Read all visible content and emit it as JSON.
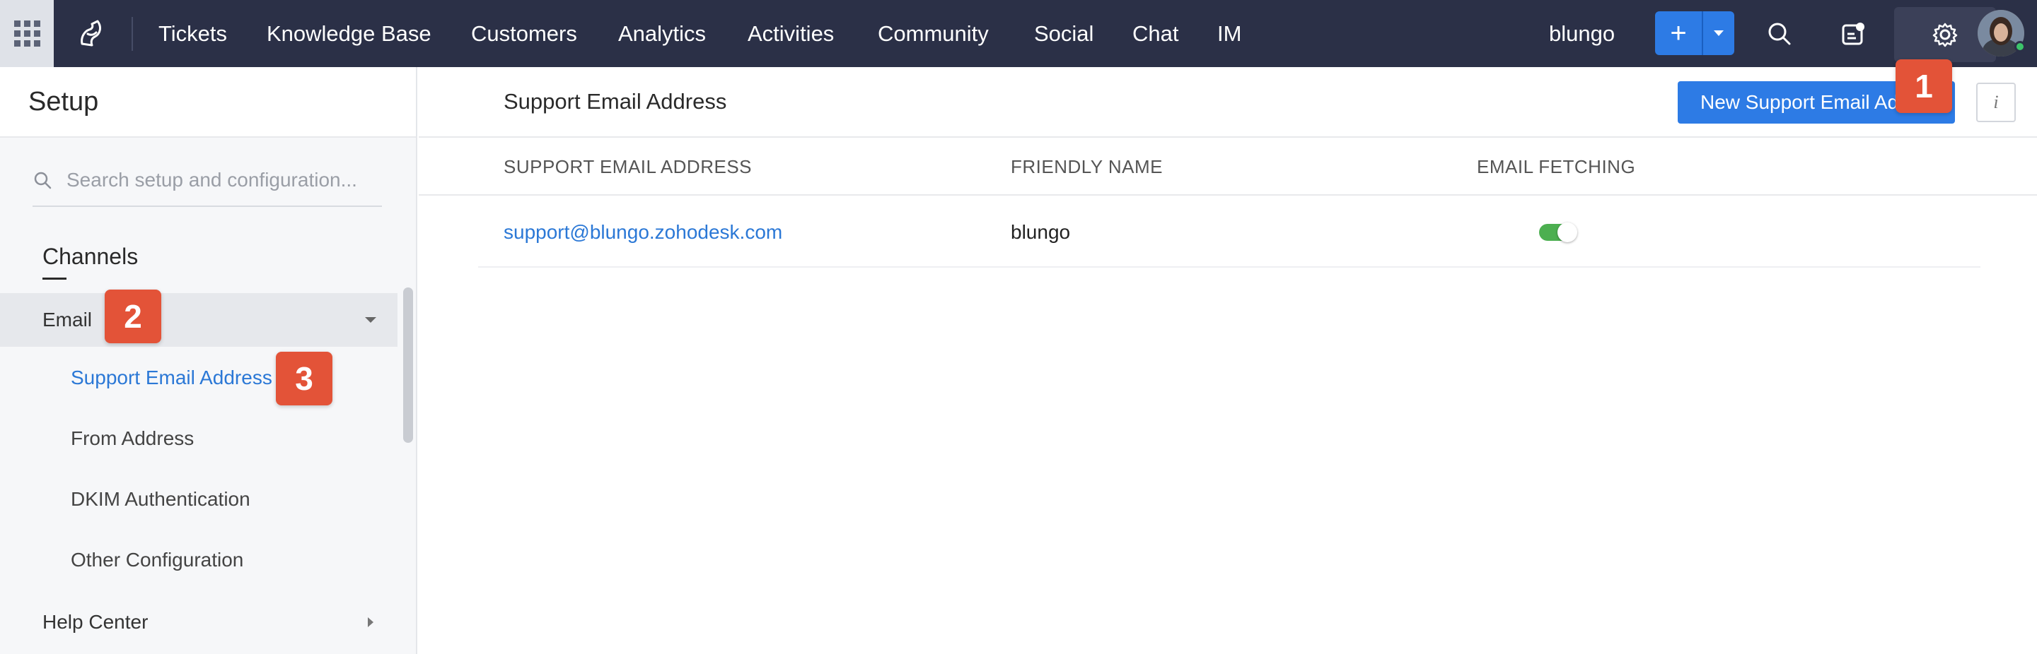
{
  "topbar": {
    "nav": [
      "Tickets",
      "Knowledge Base",
      "Customers",
      "Analytics",
      "Activities",
      "Community",
      "Social",
      "Chat",
      "IM"
    ],
    "org": "blungo",
    "add_label": "+",
    "icons": {
      "apps": "apps-grid-icon",
      "logo": "zoho-desk-logo",
      "search": "search-icon",
      "notifications": "notification-icon",
      "settings": "gear-icon"
    },
    "accent": "#2d7be5",
    "bg": "#2b3047"
  },
  "sidebar": {
    "title": "Setup",
    "search_placeholder": "Search setup and configuration...",
    "section": "Channels",
    "group": "Email",
    "sub_items": [
      "Support Email Address",
      "From Address",
      "DKIM Authentication",
      "Other Configuration"
    ],
    "selected": "Support Email Address",
    "next_group": "Help Center"
  },
  "main": {
    "title": "Support Email Address",
    "new_button": "New Support Email Address",
    "info_label": "i",
    "columns": [
      "SUPPORT EMAIL ADDRESS",
      "FRIENDLY NAME",
      "EMAIL FETCHING"
    ],
    "rows": [
      {
        "email": "support@blungo.zohodesk.com",
        "friendly_name": "blungo",
        "fetching": true
      }
    ]
  },
  "badges": [
    "1",
    "2",
    "3"
  ]
}
